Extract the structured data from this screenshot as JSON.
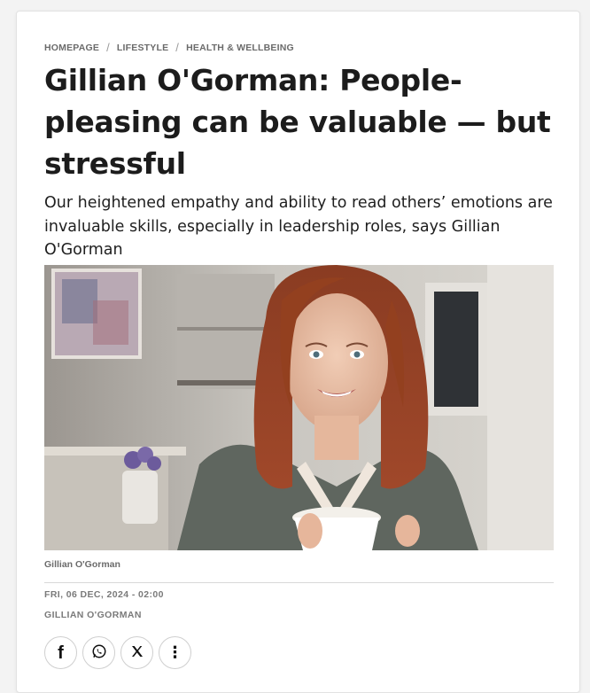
{
  "breadcrumb": {
    "items": [
      {
        "label": "HOMEPAGE"
      },
      {
        "label": "LIFESTYLE"
      },
      {
        "label": "HEALTH & WELLBEING"
      }
    ],
    "separator": "/"
  },
  "article": {
    "headline": "Gillian O'Gorman: People-pleasing can be valuable — but stressful",
    "standfirst": "Our heightened empathy and ability to read others’ emotions are invaluable skills, especially in leadership roles, says Gillian O'Gorman",
    "image_caption": "Gillian O'Gorman",
    "date": "FRI, 06 DEC, 2024 - 02:00",
    "author": "GILLIAN O'GORMAN"
  },
  "share": {
    "buttons": [
      {
        "icon": "facebook-icon",
        "glyph": "f"
      },
      {
        "icon": "whatsapp-icon",
        "glyph": "✆"
      },
      {
        "icon": "x-icon",
        "glyph": "𝕏"
      },
      {
        "icon": "more-icon",
        "glyph": "⋮"
      }
    ]
  },
  "colors": {
    "meta_text": "#6b6b6b",
    "headline_text": "#1c1c1c",
    "divider": "#d8d8d8"
  }
}
